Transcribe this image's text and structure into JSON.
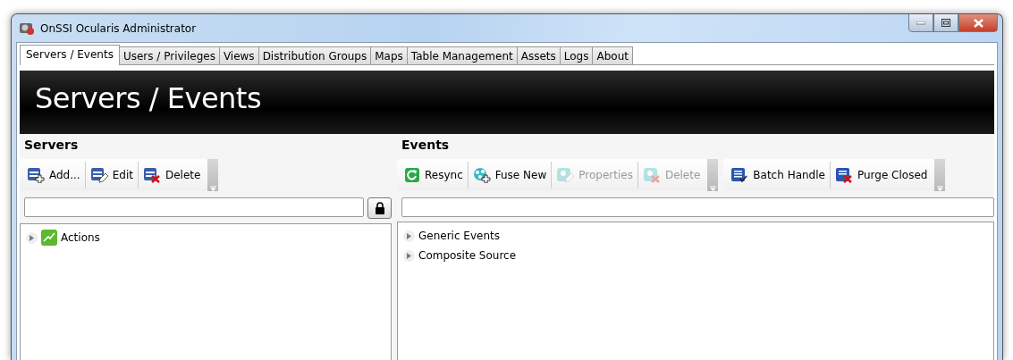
{
  "window": {
    "title": "OnSSI Ocularis Administrator"
  },
  "tabs": [
    {
      "label": "Servers / Events",
      "selected": true
    },
    {
      "label": "Users / Privileges",
      "selected": false
    },
    {
      "label": "Views",
      "selected": false
    },
    {
      "label": "Distribution Groups",
      "selected": false
    },
    {
      "label": "Maps",
      "selected": false
    },
    {
      "label": "Table Management",
      "selected": false
    },
    {
      "label": "Assets",
      "selected": false
    },
    {
      "label": "Logs",
      "selected": false
    },
    {
      "label": "About",
      "selected": false
    }
  ],
  "banner": {
    "title": "Servers / Events"
  },
  "servers": {
    "heading": "Servers",
    "toolbars": [
      [
        {
          "label": "Add...",
          "disabled": false
        },
        {
          "label": "Edit",
          "disabled": false
        },
        {
          "label": "Delete",
          "disabled": false
        }
      ]
    ],
    "tree": [
      {
        "label": "Actions",
        "expanded": false
      }
    ]
  },
  "events": {
    "heading": "Events",
    "toolbars": [
      [
        {
          "label": "Resync",
          "disabled": false
        },
        {
          "label": "Fuse New",
          "disabled": false
        },
        {
          "label": "Properties",
          "disabled": true
        },
        {
          "label": "Delete",
          "disabled": true
        }
      ],
      [
        {
          "label": "Batch Handle",
          "disabled": false
        },
        {
          "label": "Purge Closed",
          "disabled": false
        }
      ]
    ],
    "tree": [
      {
        "label": "Generic Events",
        "expanded": false
      },
      {
        "label": "Composite Source",
        "expanded": false
      }
    ]
  }
}
